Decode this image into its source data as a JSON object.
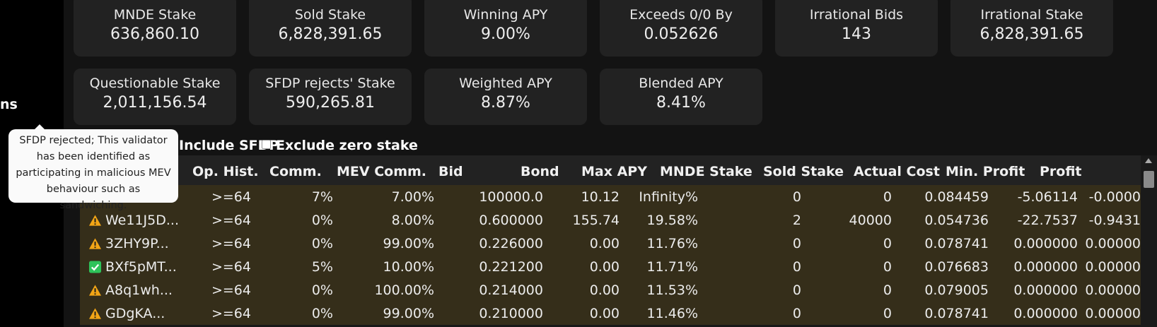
{
  "sidebar": {
    "fragment": "ns"
  },
  "stats_row1": [
    {
      "label": "MNDE Stake",
      "value": "636,860.10"
    },
    {
      "label": "Sold Stake",
      "value": "6,828,391.65"
    },
    {
      "label": "Winning APY",
      "value": "9.00%"
    },
    {
      "label": "Exceeds 0/0 By",
      "value": "0.052626"
    },
    {
      "label": "Irrational Bids",
      "value": "143"
    },
    {
      "label": "Irrational Stake",
      "value": "6,828,391.65"
    }
  ],
  "stats_row2": [
    {
      "label": "Questionable Stake",
      "value": "2,011,156.54"
    },
    {
      "label": "SFDP rejects' Stake",
      "value": "590,265.81"
    },
    {
      "label": "Weighted APY",
      "value": "8.87%"
    },
    {
      "label": "Blended APY",
      "value": "8.41%"
    }
  ],
  "filters": {
    "include_sfdp": "Include SFDP",
    "exclude_zero": "Exclude zero stake"
  },
  "table": {
    "headers": [
      "Op. Hist.",
      "Comm.",
      "MEV Comm.",
      "Bid",
      "Bond",
      "Max APY",
      "MNDE Stake",
      "Sold Stake",
      "Actual Cost",
      "Min. Profit",
      "Profit"
    ],
    "rows": [
      {
        "status": "warning",
        "name": "",
        "cells": [
          ">=64",
          "7%",
          "7.00%",
          "100000.0",
          "10.12",
          "Infinity%",
          "0",
          "0",
          "0.084459",
          "-5.06114",
          "-0.0000"
        ]
      },
      {
        "status": "warning",
        "name": "We11J5D...",
        "cells": [
          ">=64",
          "0%",
          "8.00%",
          "0.600000",
          "155.74",
          "19.58%",
          "2",
          "40000",
          "0.054736",
          "-22.7537",
          "-0.9431"
        ]
      },
      {
        "status": "warning",
        "name": "3ZHY9P...",
        "cells": [
          ">=64",
          "0%",
          "99.00%",
          "0.226000",
          "0.00",
          "11.76%",
          "0",
          "0",
          "0.078741",
          "0.000000",
          "0.00000"
        ]
      },
      {
        "status": "ok",
        "name": "BXf5pMT...",
        "cells": [
          ">=64",
          "5%",
          "10.00%",
          "0.221200",
          "0.00",
          "11.71%",
          "0",
          "0",
          "0.076683",
          "0.000000",
          "0.00000"
        ]
      },
      {
        "status": "warning",
        "name": "A8q1wh...",
        "cells": [
          ">=64",
          "0%",
          "100.00%",
          "0.214000",
          "0.00",
          "11.53%",
          "0",
          "0",
          "0.079005",
          "0.000000",
          "0.00000"
        ]
      },
      {
        "status": "warning",
        "name": "GDgKA...",
        "cells": [
          ">=64",
          "0%",
          "99.00%",
          "0.210000",
          "0.00",
          "11.46%",
          "0",
          "0",
          "0.078741",
          "0.000000",
          "0.00000"
        ]
      }
    ]
  },
  "tooltip": {
    "text": "SFDP rejected; This validator has been identified as participating in malicious MEV behaviour such as sandwiching."
  },
  "colors": {
    "row_bg": "#352e1a",
    "warning": "#f2a516",
    "ok": "#2ec35a",
    "card_bg": "#222222"
  },
  "icons": {
    "warning": "warning-icon",
    "ok": "check-icon"
  }
}
